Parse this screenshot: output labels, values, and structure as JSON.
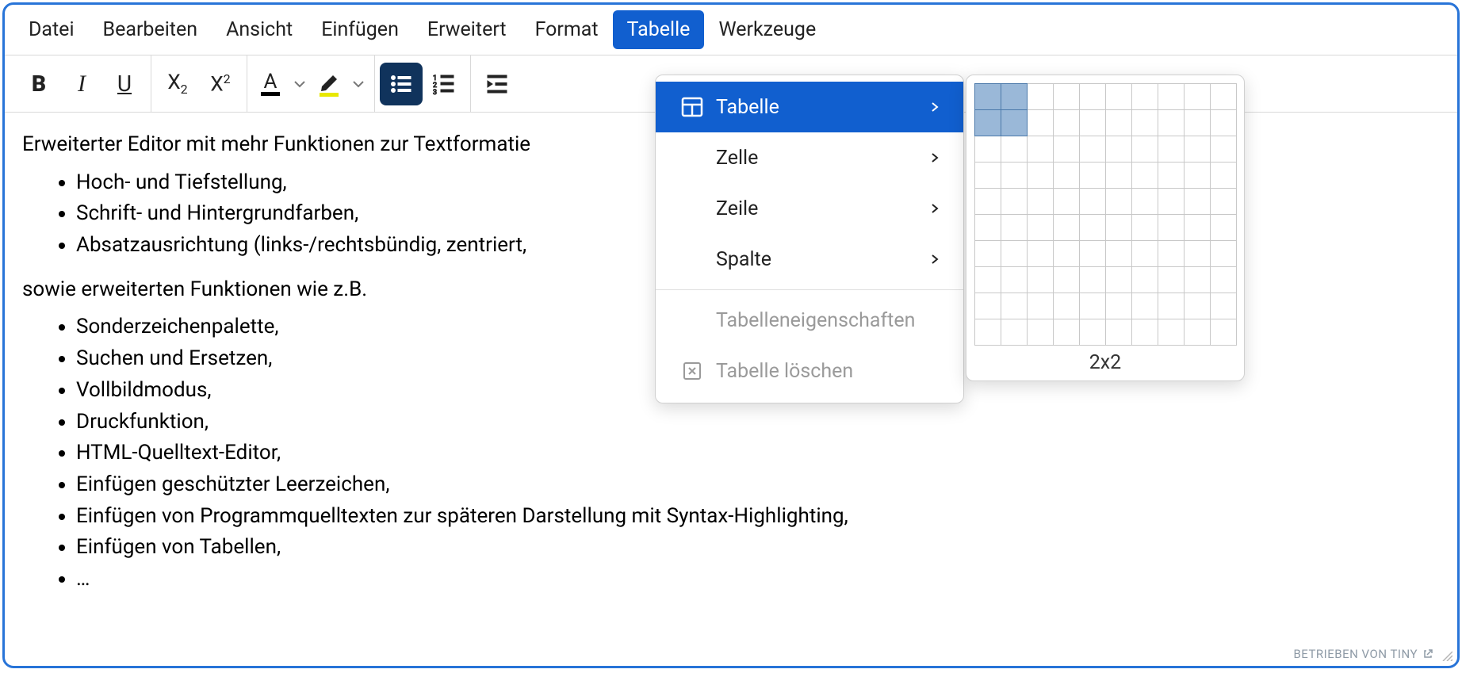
{
  "menubar": {
    "items": [
      {
        "label": "Datei"
      },
      {
        "label": "Bearbeiten"
      },
      {
        "label": "Ansicht"
      },
      {
        "label": "Einfügen"
      },
      {
        "label": "Erweitert"
      },
      {
        "label": "Format"
      },
      {
        "label": "Tabelle"
      },
      {
        "label": "Werkzeuge"
      }
    ],
    "active_index": 6
  },
  "content": {
    "intro": "Erweiterter Editor mit mehr Funktionen zur Textformatie",
    "list1": [
      "Hoch- und Tiefstellung,",
      "Schrift- und Hintergrundfarben,",
      "Absatzausrichtung (links-/rechtsbündig, zentriert,"
    ],
    "bridge": "sowie erweiterten Funktionen wie z.B.",
    "list2": [
      "Sonderzeichenpalette,",
      "Suchen und Ersetzen,",
      "Vollbildmodus,",
      "Druckfunktion,",
      "HTML-Quelltext-Editor,",
      "Einfügen geschützter Leerzeichen,",
      "Einfügen von Programmquelltexten zur späteren Darstellung mit Syntax-Highlighting,",
      "Einfügen von Tabellen,",
      "…"
    ]
  },
  "dropdown": {
    "items": [
      {
        "label": "Tabelle",
        "icon": "table",
        "has_sub": true,
        "active": true
      },
      {
        "label": "Zelle",
        "icon": "",
        "has_sub": true
      },
      {
        "label": "Zeile",
        "icon": "",
        "has_sub": true
      },
      {
        "label": "Spalte",
        "icon": "",
        "has_sub": true
      }
    ],
    "lower": [
      {
        "label": "Tabelleneigenschaften",
        "icon": "",
        "disabled": true
      },
      {
        "label": "Tabelle löschen",
        "icon": "delete-table",
        "disabled": true
      }
    ]
  },
  "grid_picker": {
    "rows": 10,
    "cols": 10,
    "sel_rows": 2,
    "sel_cols": 2,
    "label": "2x2"
  },
  "footer": {
    "brand": "BETRIEBEN VON TINY"
  },
  "colors": {
    "text_color_underline": "#000000",
    "highlight_color_underline": "#e8e800"
  }
}
